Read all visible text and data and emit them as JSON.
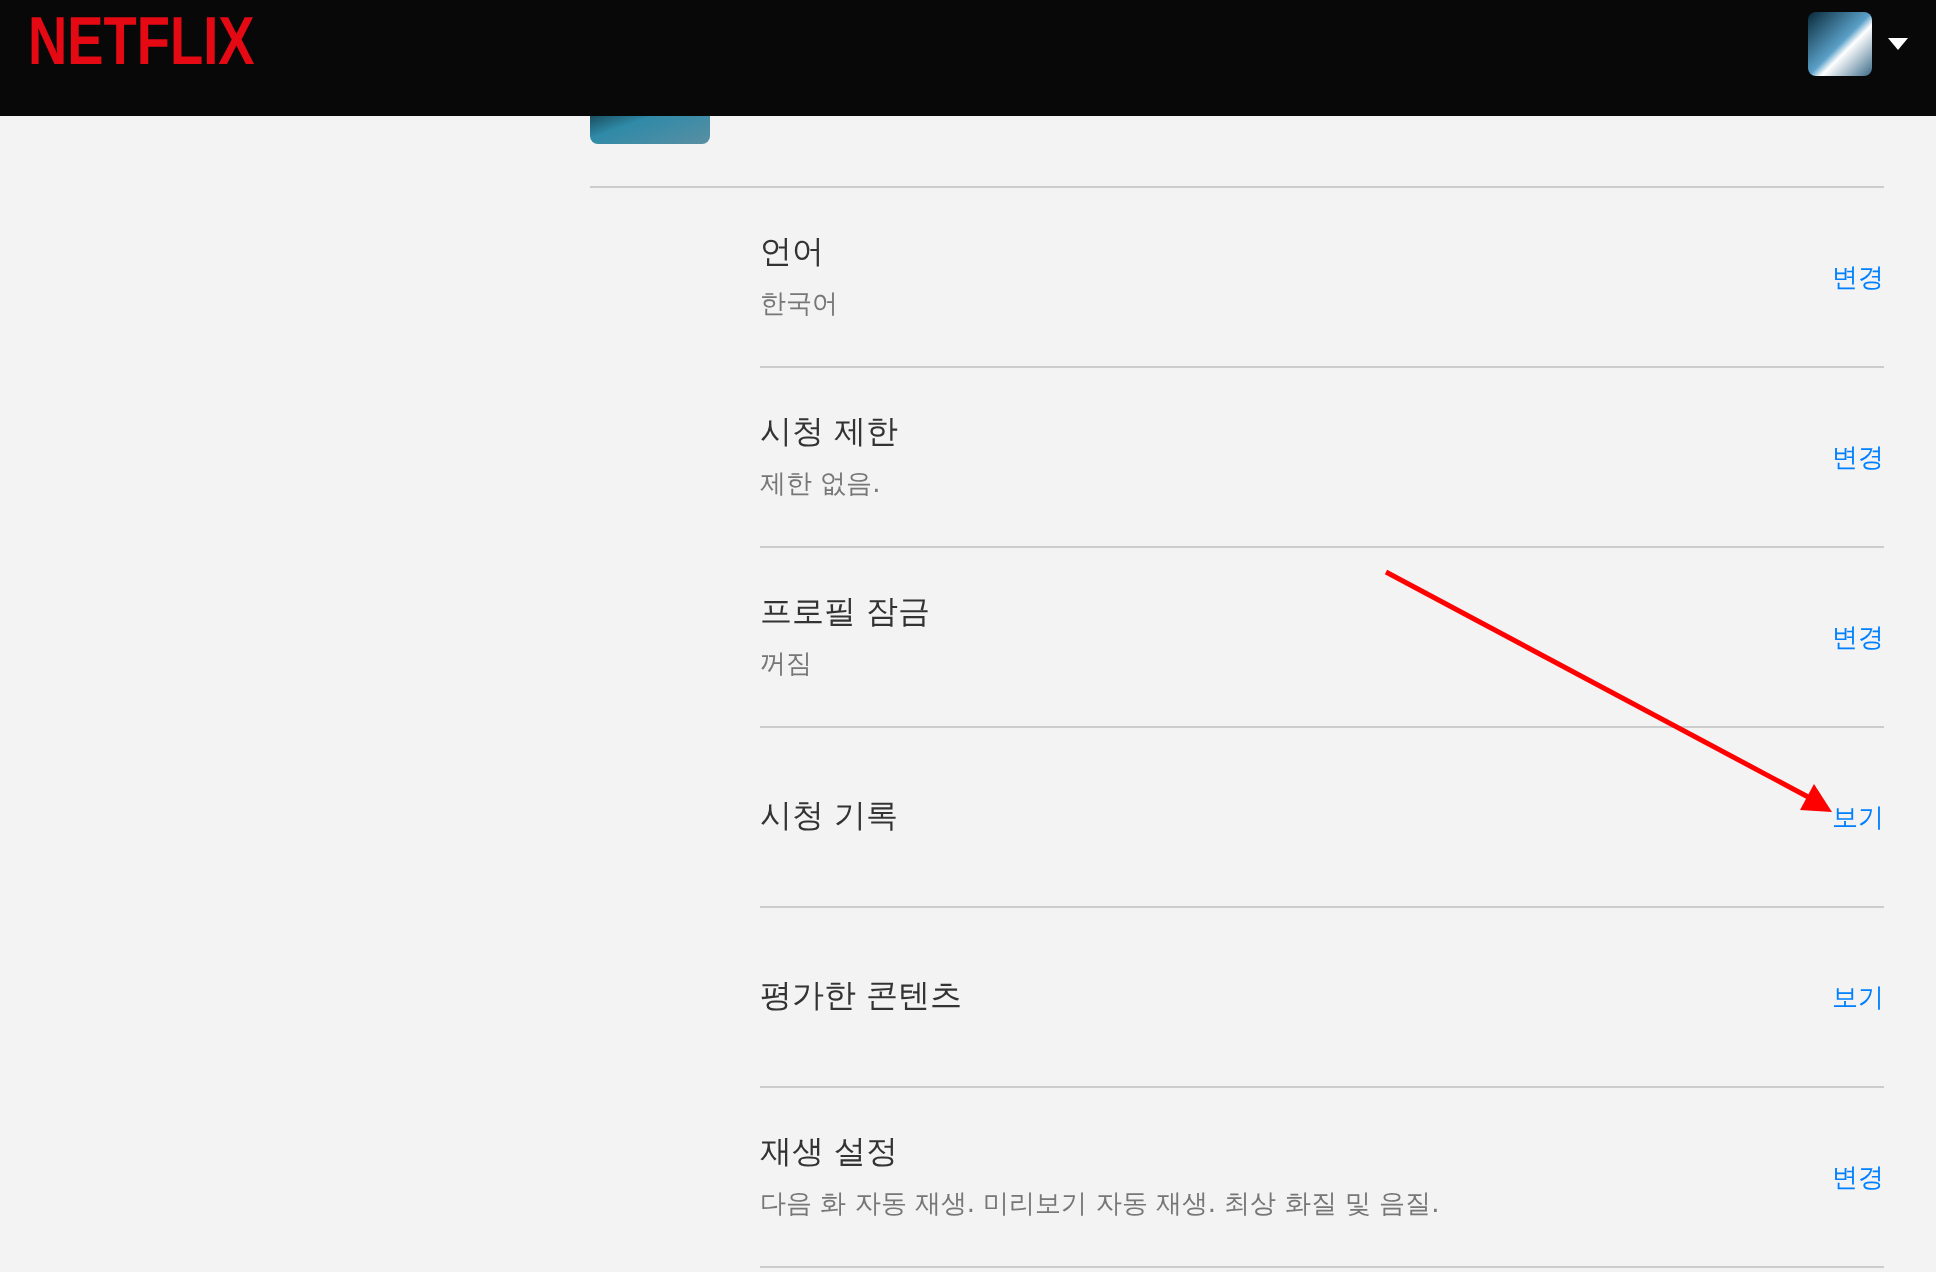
{
  "header": {
    "logo": "NETFLIX"
  },
  "settings": [
    {
      "title": "언어",
      "value": "한국어",
      "action": "변경",
      "arrow": false
    },
    {
      "title": "시청 제한",
      "value": "제한 없음.",
      "action": "변경",
      "arrow": false
    },
    {
      "title": "프로필 잠금",
      "value": "꺼짐",
      "action": "변경",
      "arrow": false
    },
    {
      "title": "시청 기록",
      "action": "보기",
      "arrow": true
    },
    {
      "title": "평가한 콘텐츠",
      "action": "보기",
      "arrow": false
    },
    {
      "title": "재생 설정",
      "value": "다음 화 자동 재생. 미리보기 자동 재생. 최상 화질 및 음질.",
      "action": "변경",
      "arrow": false
    }
  ]
}
